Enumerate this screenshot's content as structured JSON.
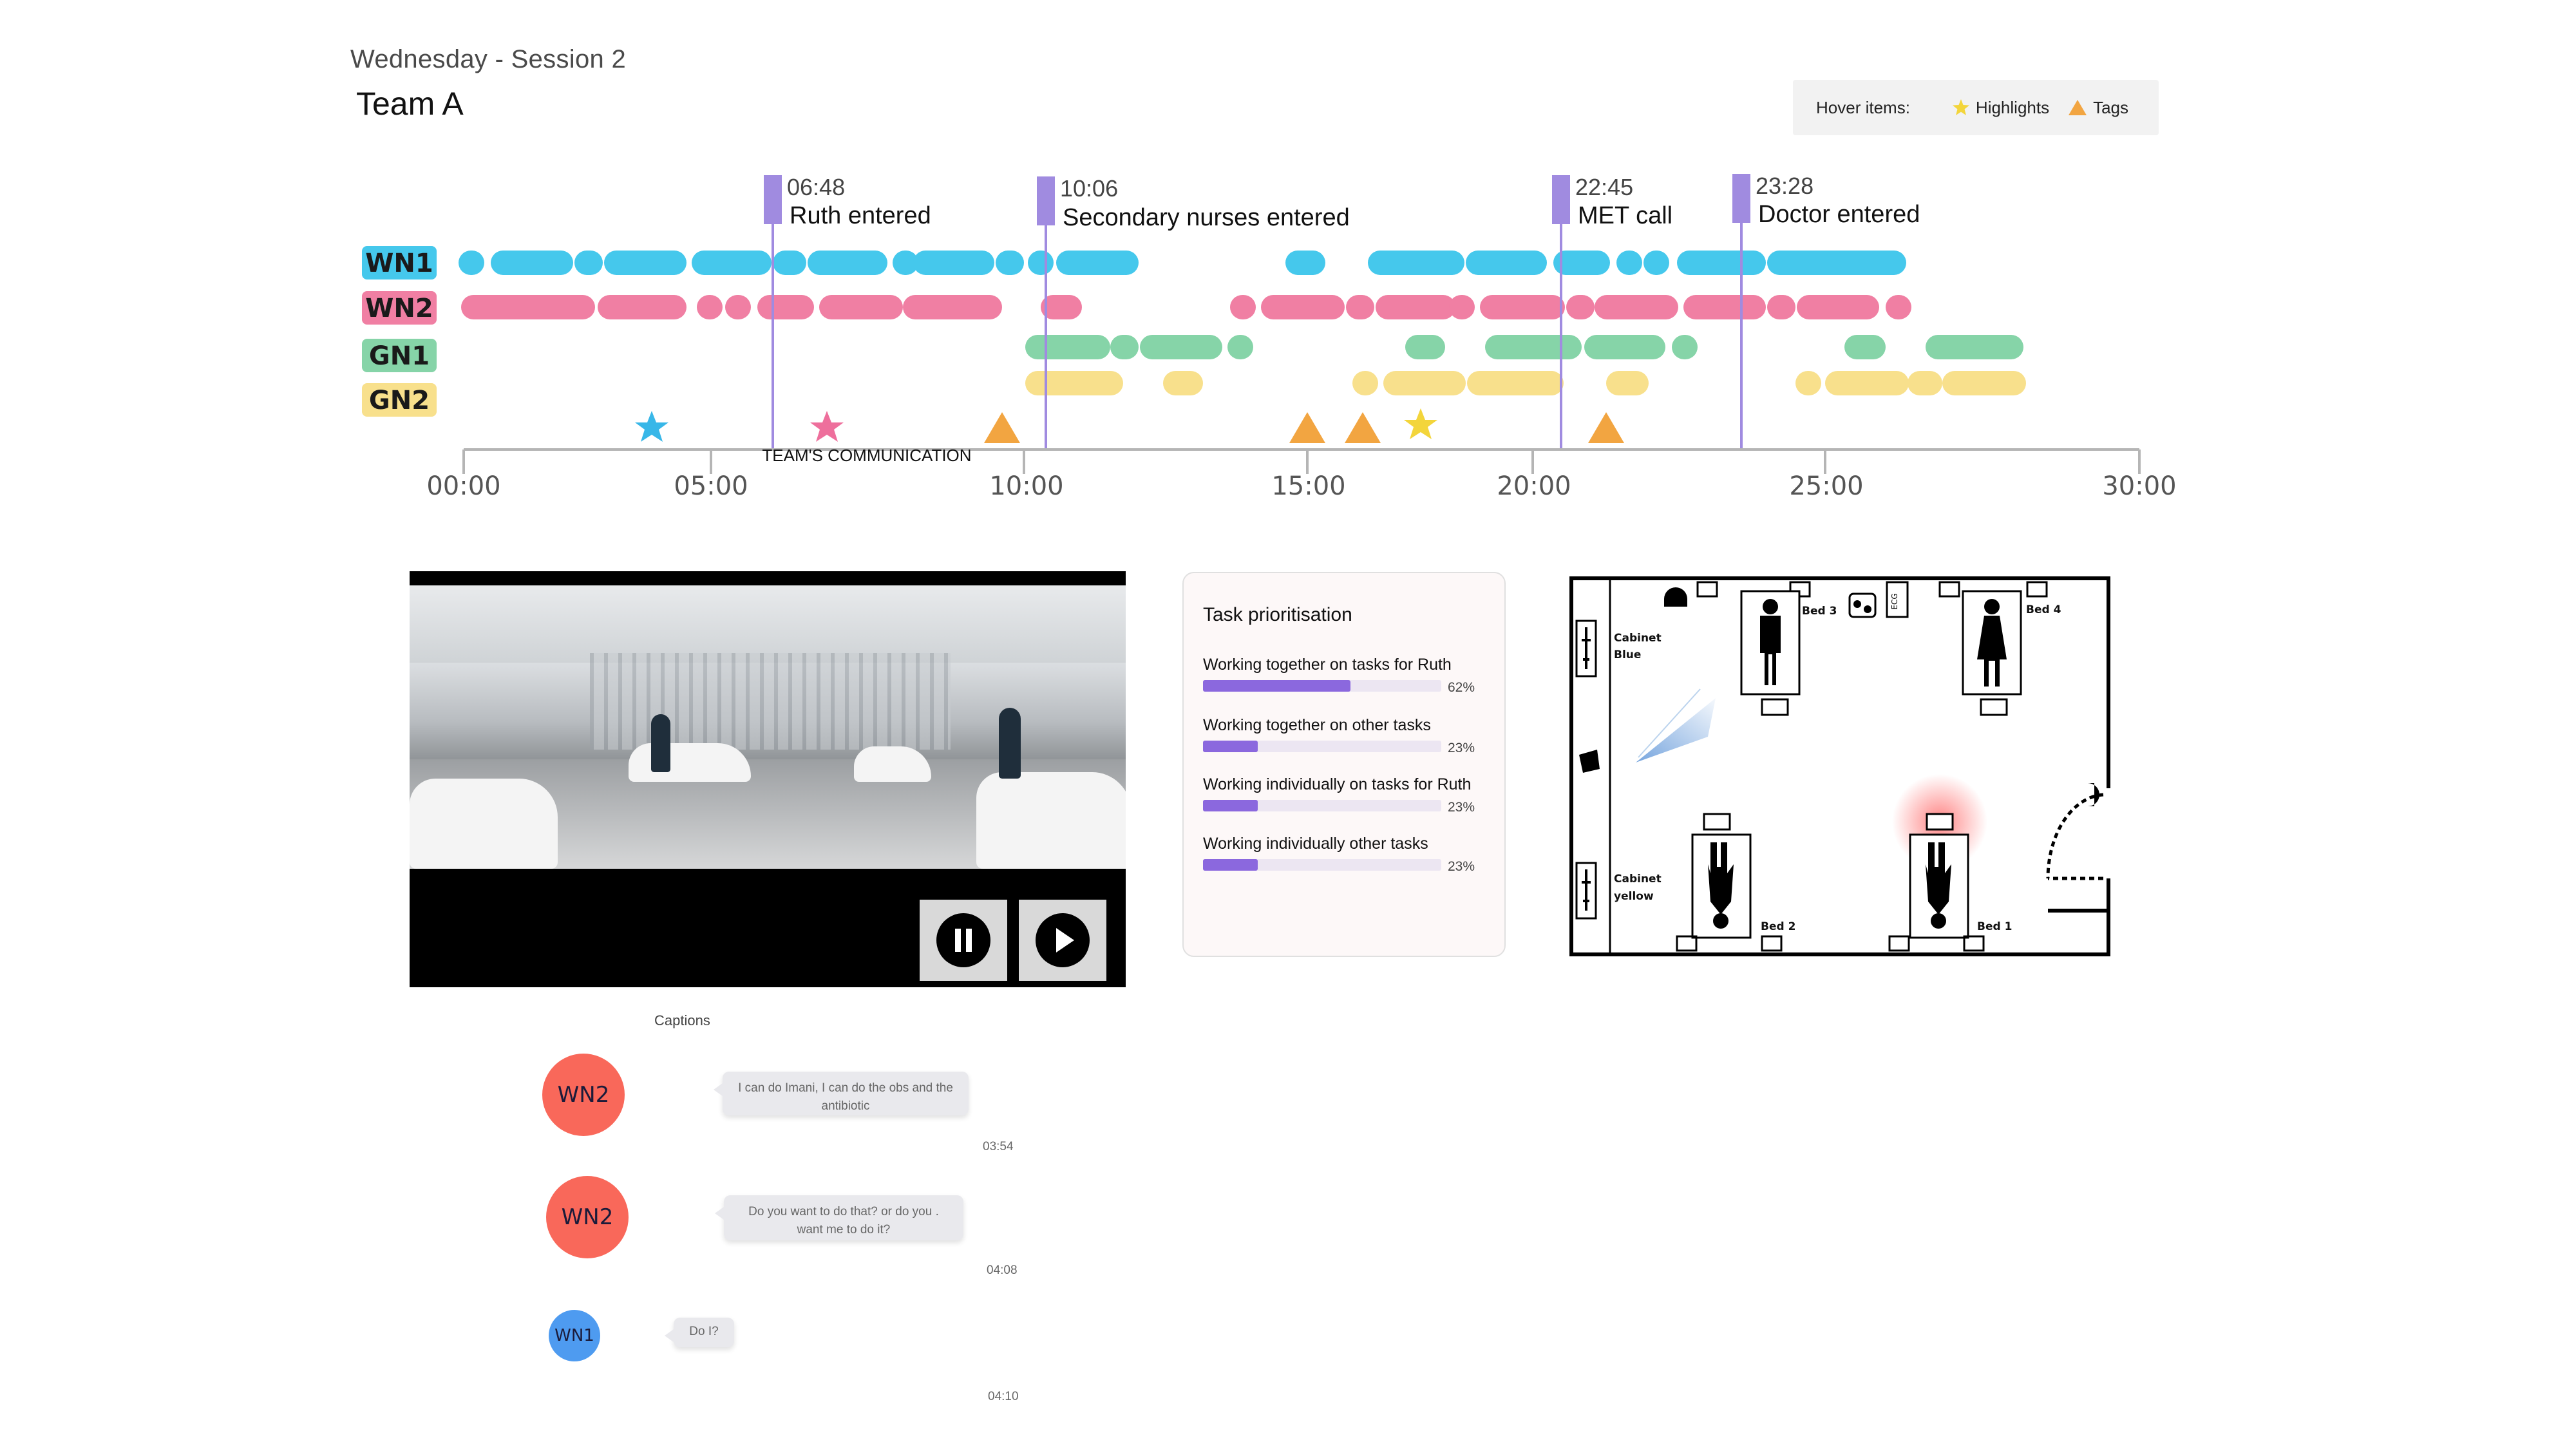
{
  "header": {
    "session": "Wednesday - Session 2",
    "team": "Team A"
  },
  "legend": {
    "label": "Hover items:",
    "items": [
      {
        "icon": "star-icon",
        "label": "Highlights",
        "color": "#f3d53b"
      },
      {
        "icon": "triangle-icon",
        "label": "Tags",
        "color": "#f2a541"
      }
    ]
  },
  "timeline": {
    "axis_caption": "TEAM'S COMMUNICATION",
    "ticks": [
      "00:00",
      "05:00",
      "10:00",
      "15:00",
      "20:00",
      "25:00",
      "30:00"
    ],
    "events": [
      {
        "time": "06:48",
        "label": "Ruth entered"
      },
      {
        "time": "10:06",
        "label": "Secondary nurses entered"
      },
      {
        "time": "22:45",
        "label": "MET call"
      },
      {
        "time": "23:28",
        "label": "Doctor entered"
      }
    ],
    "roles": [
      {
        "name": "WN1",
        "color": "#45c8ec"
      },
      {
        "name": "WN2",
        "color": "#f07fa3"
      },
      {
        "name": "GN1",
        "color": "#86d4a8"
      },
      {
        "name": "GN2",
        "color": "#f8e08c"
      }
    ],
    "marker_colors": {
      "event": "#a08be0",
      "star_blue": "#38b7e8",
      "star_pink": "#ee6f9c",
      "star_yellow": "#f3d53b",
      "tag": "#f2a541"
    }
  },
  "video": {
    "controls": [
      {
        "name": "pause-button",
        "icon": "pause-icon"
      },
      {
        "name": "play-button",
        "icon": "play-icon"
      }
    ]
  },
  "task_prioritisation": {
    "title": "Task prioritisation",
    "items": [
      {
        "label": "Working together on tasks for Ruth",
        "percent": 62,
        "percent_label": "62%"
      },
      {
        "label": "Working together on other tasks",
        "percent": 23,
        "percent_label": "23%"
      },
      {
        "label": "Working individually on tasks for Ruth",
        "percent": 23,
        "percent_label": "23%"
      },
      {
        "label": "Working individually other tasks",
        "percent": 23,
        "percent_label": "23%"
      }
    ]
  },
  "floor_plan": {
    "labels": {
      "bed1": "Bed 1",
      "bed2": "Bed 2",
      "bed3": "Bed 3",
      "bed4": "Bed 4",
      "cabinet_blue_1": "Cabinet",
      "cabinet_blue_2": "Blue",
      "cabinet_yellow_1": "Cabinet",
      "cabinet_yellow_2": "yellow",
      "ecg": "ECG"
    },
    "alert_color": "#ff5a5a"
  },
  "captions": {
    "title": "Captions",
    "messages": [
      {
        "speaker": "WN2",
        "color": "#f9685a",
        "text": "I can do Imani, I can do the obs and the antibiotic",
        "time": "03:54"
      },
      {
        "speaker": "WN2",
        "color": "#f9685a",
        "text": "Do you want to do that? or do you . want me to do it?",
        "time": "04:08"
      },
      {
        "speaker": "WN1",
        "color": "#4e9bf0",
        "text": "Do I?",
        "time": "04:10"
      }
    ]
  }
}
